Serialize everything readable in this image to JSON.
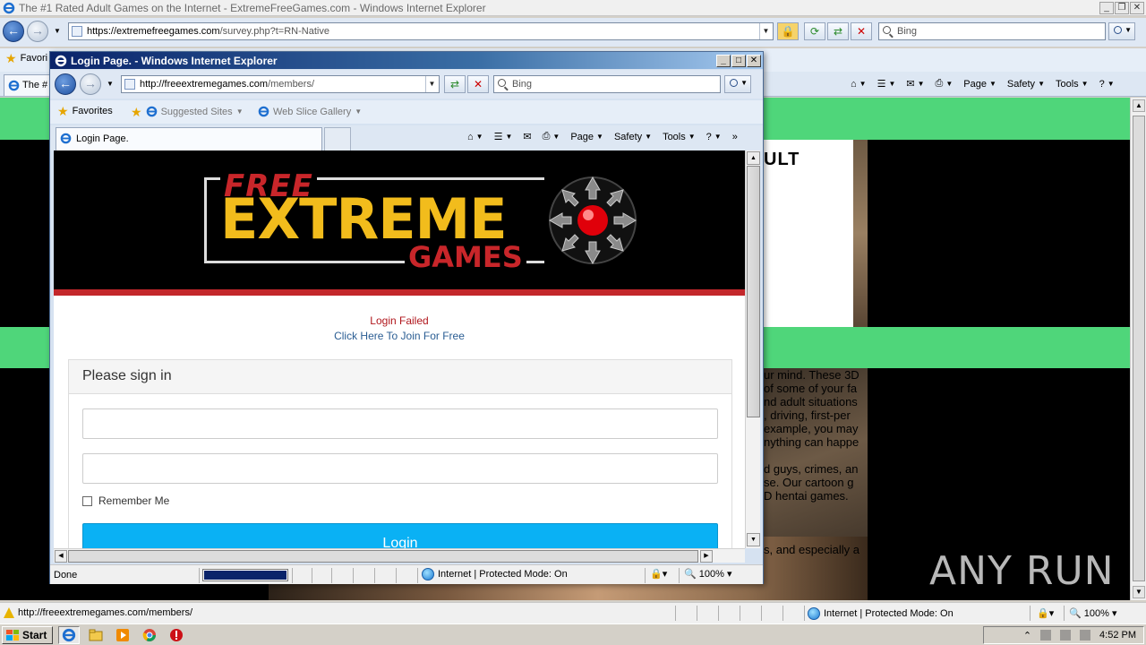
{
  "bg_window": {
    "title": "The #1 Rated Adult Games on the Internet - ExtremeFreeGames.com - Windows Internet Explorer",
    "address_host": "https://extremefreegames.com",
    "address_path": "/survey.php?t=RN-Native",
    "search_placeholder": "Bing",
    "favorites_label": "Favori",
    "tab_label": "The #",
    "commands": {
      "page": "Page",
      "safety": "Safety",
      "tools": "Tools"
    },
    "page_heading_fragment": "ULT",
    "paragraph_fragments": [
      "ur mind. These 3D",
      "of some of your fa",
      "nd adult situations",
      ", driving, first-per",
      "example, you may",
      "nything can happe",
      "",
      "d guys, crimes, an",
      "se. Our cartoon g",
      "D hentai games.",
      "",
      "",
      "",
      "s, and especially a"
    ],
    "status_url": "http://freeextremegames.com/members/",
    "status_zone": "Internet | Protected Mode: On",
    "status_zoom": "100%"
  },
  "popup": {
    "title": "Login Page. - Windows Internet Explorer",
    "address_host": "http://freeextremegames.com",
    "address_path": "/members/",
    "search_placeholder": "Bing",
    "favorites": {
      "label": "Favorites",
      "suggested": "Suggested Sites",
      "web_slice": "Web Slice Gallery"
    },
    "tab_label": "Login Page.",
    "commands": {
      "page": "Page",
      "safety": "Safety",
      "tools": "Tools"
    },
    "status_done": "Done",
    "status_zone": "Internet | Protected Mode: On",
    "status_zoom": "100%",
    "progress": 1.0
  },
  "site": {
    "logo": {
      "free": "FREE",
      "extreme": "EXTREME",
      "games": "GAMES"
    },
    "login_failed": "Login Failed",
    "join_link": "Click Here To Join For Free",
    "panel_title": "Please sign in",
    "username_value": "",
    "password_value": "",
    "remember_label": "Remember Me",
    "login_button": "Login"
  },
  "watermark": "ANY RUN",
  "taskbar": {
    "start": "Start",
    "clock": "4:52 PM"
  },
  "colors": {
    "accent_green": "#4fd67a",
    "login_button": "#0ab1f4",
    "header_red": "#c3272b",
    "logo_yellow": "#f2bc1c"
  }
}
